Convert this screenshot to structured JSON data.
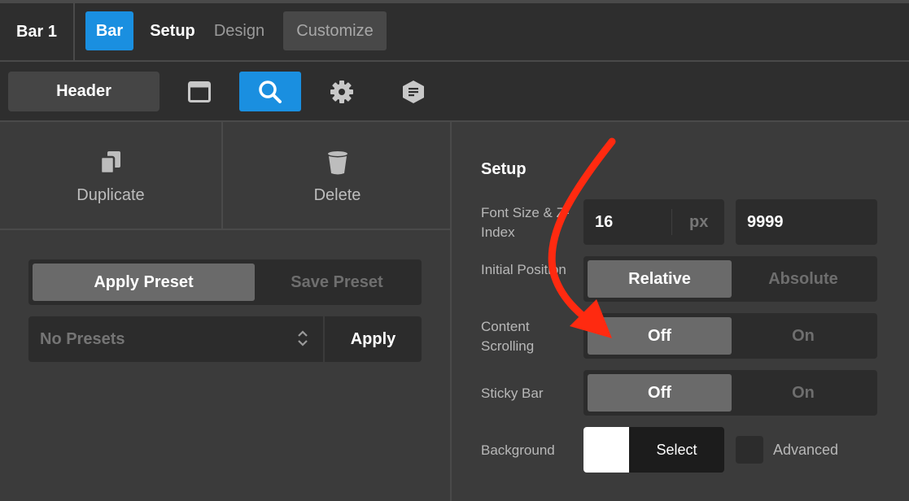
{
  "top": {
    "bar_name": "Bar 1",
    "tabs": [
      {
        "label": "Bar",
        "active": true
      },
      {
        "label": "Setup"
      },
      {
        "label": "Design"
      },
      {
        "label": "Customize"
      }
    ]
  },
  "toolbar": {
    "header_label": "Header",
    "icons": [
      "window-icon",
      "search-icon",
      "gear-icon",
      "hexagon-note-icon"
    ],
    "active_icon": "search-icon"
  },
  "actions": {
    "duplicate_label": "Duplicate",
    "delete_label": "Delete"
  },
  "presets": {
    "apply_preset_label": "Apply Preset",
    "save_preset_label": "Save Preset",
    "select_value": "No Presets",
    "apply_label": "Apply"
  },
  "setup": {
    "title": "Setup",
    "font_size_label": "Font Size & Z-Index",
    "font_size_value": "16",
    "font_size_unit": "px",
    "z_index_value": "9999",
    "initial_position_label": "Initial Position",
    "initial_position_options": [
      "Relative",
      "Absolute"
    ],
    "initial_position_selected": "Relative",
    "content_scrolling_label": "Content Scrolling",
    "content_scrolling_options": [
      "Off",
      "On"
    ],
    "content_scrolling_selected": "Off",
    "sticky_bar_label": "Sticky Bar",
    "sticky_bar_options": [
      "Off",
      "On"
    ],
    "sticky_bar_selected": "Off",
    "background_label": "Background",
    "background_select_label": "Select",
    "background_color": "#ffffff",
    "advanced_label": "Advanced"
  },
  "colors": {
    "accent": "#1a8fe0",
    "annotation_arrow": "#ff2a10"
  }
}
